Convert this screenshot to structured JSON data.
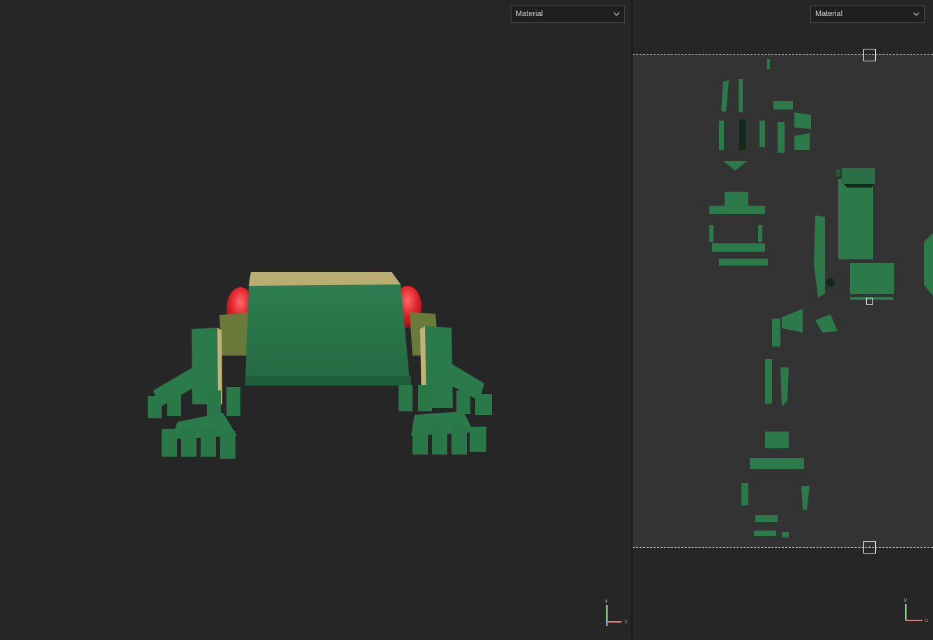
{
  "viewport_3d": {
    "shading_dropdown": {
      "label": "Material"
    },
    "axis_gizmo": {
      "y_label": "Y",
      "x_label": "X"
    }
  },
  "viewport_uv": {
    "shading_dropdown": {
      "label": "Material"
    },
    "axis_gizmo": {
      "v_label": "V",
      "u_label": "U"
    }
  },
  "colors": {
    "background": "#262626",
    "uv_sheet": "#333333",
    "frog_green": "#2e7a4c",
    "eye_red": "#d9232c"
  },
  "icons": [
    "chevron-down-icon",
    "axis-gizmo-icon"
  ]
}
